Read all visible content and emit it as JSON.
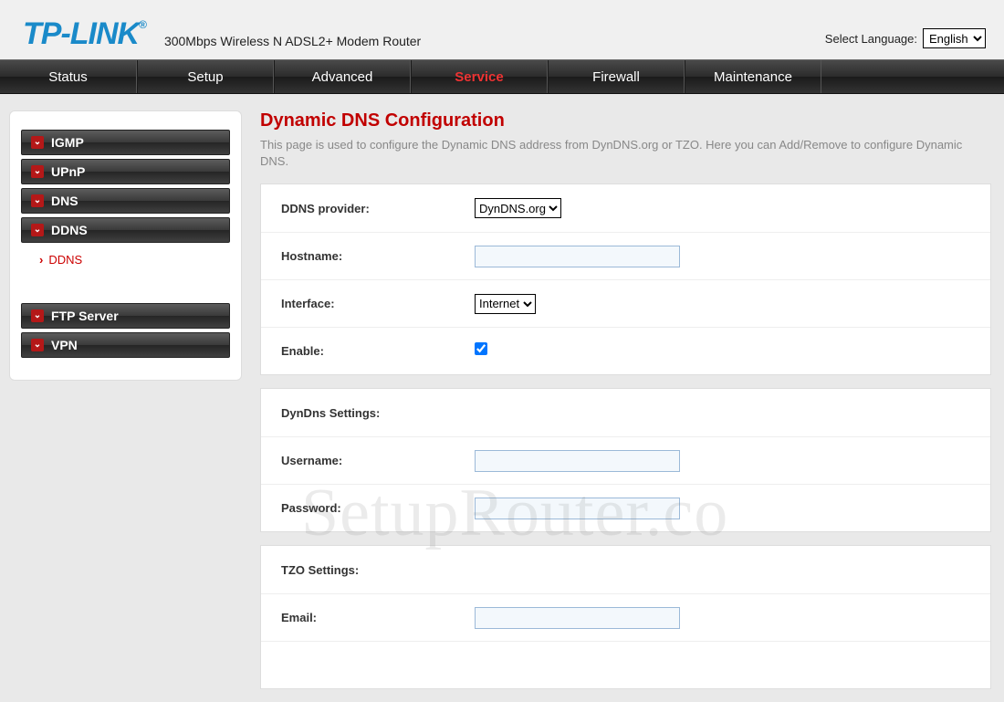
{
  "header": {
    "logo_text": "TP-LINK",
    "logo_reg": "®",
    "tagline": "300Mbps Wireless N ADSL2+ Modem Router",
    "lang_label": "Select Language:",
    "lang_value": "English"
  },
  "nav": {
    "items": [
      {
        "label": "Status",
        "active": false
      },
      {
        "label": "Setup",
        "active": false
      },
      {
        "label": "Advanced",
        "active": false
      },
      {
        "label": "Service",
        "active": true
      },
      {
        "label": "Firewall",
        "active": false
      },
      {
        "label": "Maintenance",
        "active": false
      }
    ]
  },
  "sidebar": {
    "groups": [
      {
        "label": "IGMP"
      },
      {
        "label": "UPnP"
      },
      {
        "label": "DNS"
      },
      {
        "label": "DDNS",
        "sub": [
          {
            "label": "DDNS",
            "active": true
          }
        ]
      }
    ],
    "groups2": [
      {
        "label": "FTP Server"
      },
      {
        "label": "VPN"
      }
    ]
  },
  "page": {
    "title": "Dynamic DNS Configuration",
    "desc": "This page is used to configure the Dynamic DNS address from DynDNS.org or TZO. Here you can Add/Remove to configure Dynamic DNS."
  },
  "form": {
    "ddns_provider_label": "DDNS provider:",
    "ddns_provider_value": "DynDNS.org",
    "hostname_label": "Hostname:",
    "hostname_value": "",
    "interface_label": "Interface:",
    "interface_value": "Internet",
    "enable_label": "Enable:",
    "enable_checked": true,
    "dyndns_section": "DynDns Settings:",
    "username_label": "Username:",
    "username_value": "",
    "password_label": "Password:",
    "password_value": "",
    "tzo_section": "TZO Settings:",
    "email_label": "Email:",
    "email_value": ""
  },
  "watermark": "SetupRouter.co"
}
